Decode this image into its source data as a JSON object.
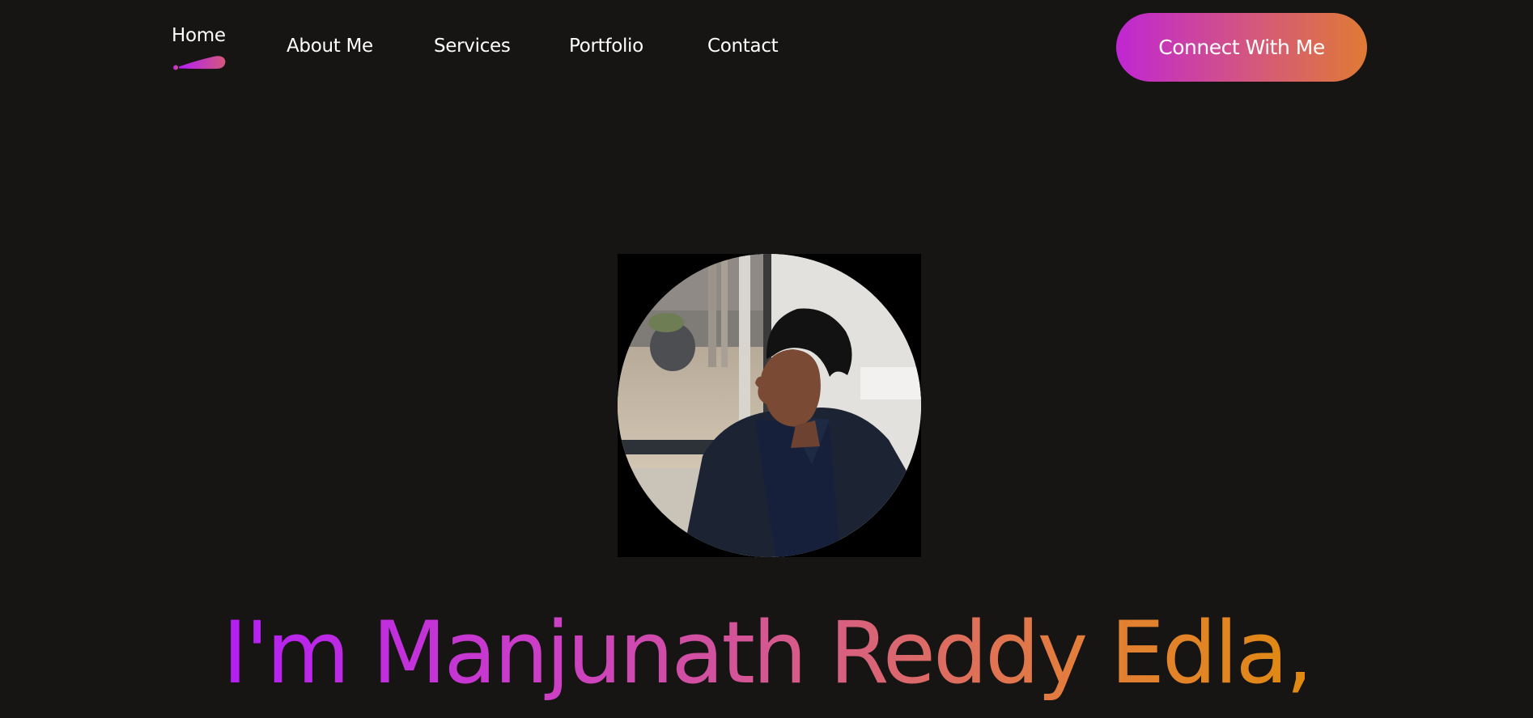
{
  "nav": {
    "items": [
      {
        "label": "Home",
        "active": true
      },
      {
        "label": "About Me",
        "active": false
      },
      {
        "label": "Services",
        "active": false
      },
      {
        "label": "Portfolio",
        "active": false
      },
      {
        "label": "Contact",
        "active": false
      }
    ],
    "cta_label": "Connect With Me"
  },
  "hero": {
    "heading": "I'm Manjunath Reddy Edla,"
  },
  "colors": {
    "background": "#161513",
    "text": "#ffffff",
    "accent_start": "#c026d3",
    "accent_mid": "#d4587c",
    "accent_end": "#e07a35",
    "heading_gradient": [
      "#b41ef5",
      "#cc3fc5",
      "#d8617c",
      "#e37d3c",
      "#e08a10"
    ]
  },
  "icons": {
    "active_indicator": "drop-indicator-icon"
  }
}
